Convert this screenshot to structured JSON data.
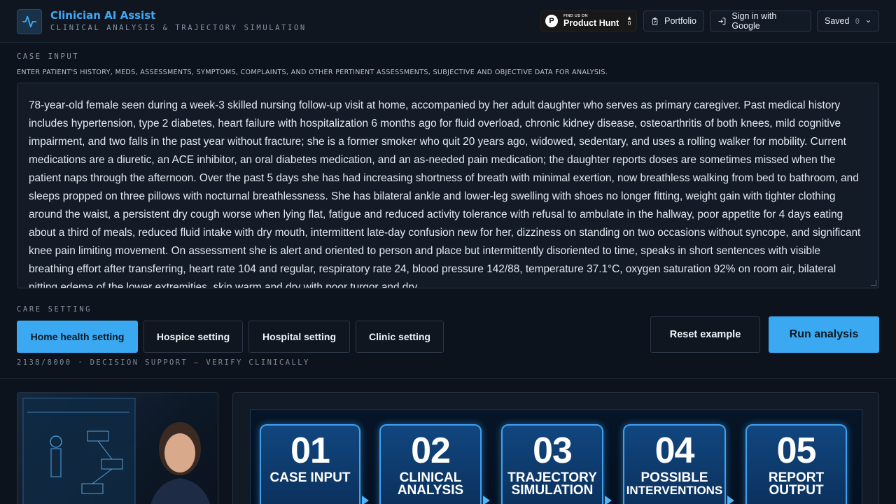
{
  "header": {
    "title": "Clinician AI Assist",
    "subtitle": "CLINICAL ANALYSIS & TRAJECTORY SIMULATION",
    "product_hunt_small": "FIND US ON",
    "product_hunt_big": "Product Hunt",
    "product_hunt_votes": "0",
    "portfolio_label": "Portfolio",
    "signin_label": "Sign in with Google",
    "saved_label": "Saved",
    "saved_count": "0"
  },
  "case_input": {
    "section_label": "CASE INPUT",
    "hint": "ENTER PATIENT'S HISTORY, MEDS, ASSESSMENTS, SYMPTOMS, COMPLAINTS, AND OTHER PERTINENT ASSESSMENTS, SUBJECTIVE AND OBJECTIVE DATA FOR ANALYSIS.",
    "text": "78-year-old female seen during a week-3 skilled nursing follow-up visit at home, accompanied by her adult daughter who serves as primary caregiver. Past medical history includes hypertension, type 2 diabetes, heart failure with hospitalization 6 months ago for fluid overload, chronic kidney disease, osteoarthritis of both knees, mild cognitive impairment, and two falls in the past year without fracture; she is a former smoker who quit 20 years ago, widowed, sedentary, and uses a rolling walker for mobility. Current medications are a diuretic, an ACE inhibitor, an oral diabetes medication, and an as-needed pain medication; the daughter reports doses are sometimes missed when the patient naps through the afternoon. Over the past 5 days she has had increasing shortness of breath with minimal exertion, now breathless walking from bed to bathroom, and sleeps propped on three pillows with nocturnal breathlessness. She has bilateral ankle and lower-leg swelling with shoes no longer fitting, weight gain with tighter clothing around the waist, a persistent dry cough worse when lying flat, fatigue and reduced activity tolerance with refusal to ambulate in the hallway, poor appetite for 4 days eating about a third of meals, reduced fluid intake with dry mouth, intermittent late-day confusion new for her, dizziness on standing on two occasions without syncope, and significant knee pain limiting movement. On assessment she is alert and oriented to person and place but intermittently disoriented to time, speaks in short sentences with visible breathing effort after transferring, heart rate 104 and regular, respiratory rate 24, blood pressure 142/88, temperature 37.1°C, oxygen saturation 92% on room air, bilateral pitting edema of the lower extremities, skin warm and dry with poor turgor and dry"
  },
  "care_setting": {
    "section_label": "CARE SETTING",
    "options": [
      "Home health setting",
      "Hospice setting",
      "Hospital setting",
      "Clinic setting"
    ],
    "selected": "Home health setting",
    "reset_label": "Reset example",
    "run_label": "Run analysis",
    "footer_note": "2138/8000 · DECISION SUPPORT — VERIFY CLINICALLY"
  },
  "steps": [
    {
      "num": "01",
      "label_line1": "CASE INPUT",
      "label_line2": ""
    },
    {
      "num": "02",
      "label_line1": "CLINICAL",
      "label_line2": "ANALYSIS"
    },
    {
      "num": "03",
      "label_line1": "TRAJECTORY",
      "label_line2": "SIMULATION"
    },
    {
      "num": "04",
      "label_line1": "POSSIBLE",
      "label_line2": "INTERVENTIONS"
    },
    {
      "num": "05",
      "label_line1": "REPORT",
      "label_line2": "OUTPUT"
    }
  ],
  "colors": {
    "accent": "#3aa9f2",
    "background": "#0d131c"
  }
}
